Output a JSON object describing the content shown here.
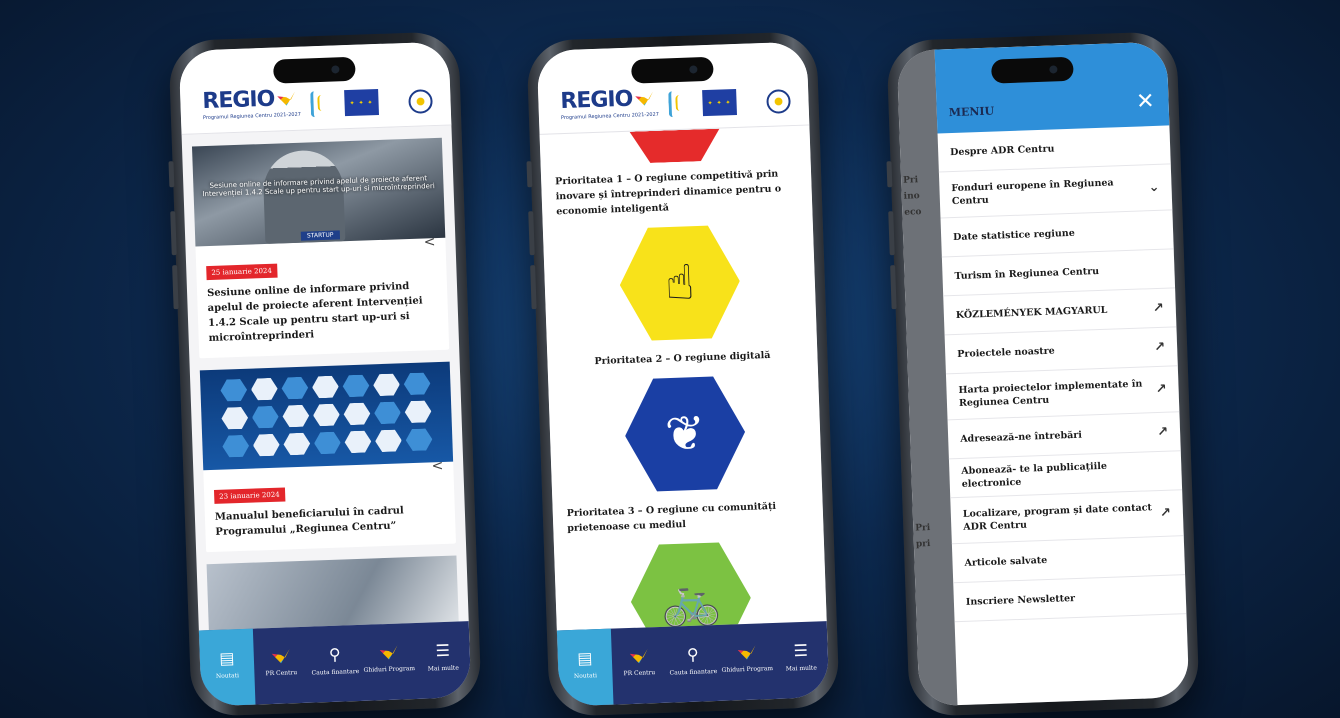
{
  "brand": {
    "logo_text": "REGIO",
    "logo_subtitle": "Programul Regiunea Centru 2021-2027"
  },
  "nav": {
    "items": [
      {
        "label": "Noutati",
        "icon": "news-icon"
      },
      {
        "label": "PR Centru",
        "icon": "regio-logo-icon"
      },
      {
        "label": "Cauta finantare",
        "icon": "search-icon"
      },
      {
        "label": "Ghiduri Program",
        "icon": "regio-logo-icon"
      },
      {
        "label": "Mai multe",
        "icon": "hamburger-icon"
      }
    ]
  },
  "phone1": {
    "cards": [
      {
        "image_text": "Sesiune online de informare privind apelul de proiecte aferent Intervenției 1.4.2 Scale up pentru start up-uri si microîntreprinderi",
        "image_tag": "STARTUP",
        "date": "25 ianuarie 2024",
        "title": "Sesiune online de informare privind apelul de proiecte aferent Intervenției 1.4.2 Scale up pentru start up-uri si microîntreprinderi"
      },
      {
        "date": "23 ianuarie 2024",
        "title": "Manualul beneficiarului în cadrul Programului „Regiunea Centru”"
      }
    ]
  },
  "phone2": {
    "priorities": [
      {
        "text": "Prioritatea 1 – O regiune competitivă prin inovare și întreprinderi dinamice pentru o economie inteligentă"
      },
      {
        "text": "Prioritatea 2 – O regiune digitală"
      },
      {
        "text": "Prioritatea 3 – O regiune cu comunități prietenoase cu mediul"
      }
    ]
  },
  "phone3": {
    "background_text": "Pri ino eco",
    "background_text_2": "Pri pri",
    "menu_title": "MENIU",
    "items": [
      {
        "label": "Despre ADR Centru",
        "suffix": ""
      },
      {
        "label": "Fonduri europene în Regiunea Centru",
        "suffix": "⌄"
      },
      {
        "label": "Date statistice regiune",
        "suffix": ""
      },
      {
        "label": "Turism în Regiunea Centru",
        "suffix": ""
      },
      {
        "label": "KÖZLEMÉNYEK MAGYARUL",
        "suffix": "↗"
      },
      {
        "label": "Proiectele noastre",
        "suffix": "↗"
      },
      {
        "label": "Harta proiectelor implementate în Regiunea Centru",
        "suffix": "↗"
      },
      {
        "label": "Adresează-ne întrebări",
        "suffix": "↗"
      },
      {
        "label": "Abonează- te la publicațiile electronice",
        "suffix": ""
      },
      {
        "label": "Localizare, program și date contact ADR Centru",
        "suffix": "↗"
      },
      {
        "label": "Articole salvate",
        "suffix": ""
      },
      {
        "label": "Inscriere Newsletter",
        "suffix": ""
      }
    ]
  },
  "colors": {
    "navbar": "#23326e",
    "nav_active": "#3aa7d8",
    "menu_header": "#2e8fd9",
    "date_badge": "#e3262b",
    "prio1": "#e52b2b",
    "prio2": "#f8e21a",
    "prio3": "#1a3fa4",
    "prio4": "#7cc242"
  }
}
